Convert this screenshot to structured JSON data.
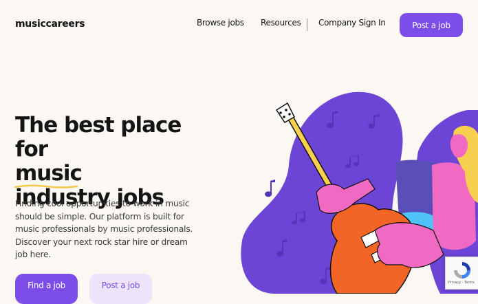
{
  "header": {
    "logo": "musiccareers",
    "nav": {
      "browse_jobs": "Browse jobs",
      "resources": "Resources",
      "company_sign_in": "Company Sign In"
    },
    "post_job_button": "Post a job"
  },
  "hero": {
    "headline": {
      "line1": "The best place",
      "line2_prefix": "for ",
      "line2_highlight": "music",
      "line3": "industry jobs"
    },
    "description": "Finding cool opportunities to work in music should be simple. Our platform is built for music professionals by music professionals. Discover your next rock star hire or dream job here.",
    "primary_cta": "Find a job",
    "secondary_cta": "Post a job"
  },
  "recaptcha": {
    "terms": "Privacy - Terms"
  },
  "colors": {
    "background": "#fbf8f3",
    "accent": "#7c4de8",
    "accent_light": "#ebe4fb",
    "blob": "#6c45d6",
    "underline": "#f2c94c"
  },
  "icons": [
    "music-note-icon",
    "guitar-icon",
    "recaptcha-icon"
  ]
}
